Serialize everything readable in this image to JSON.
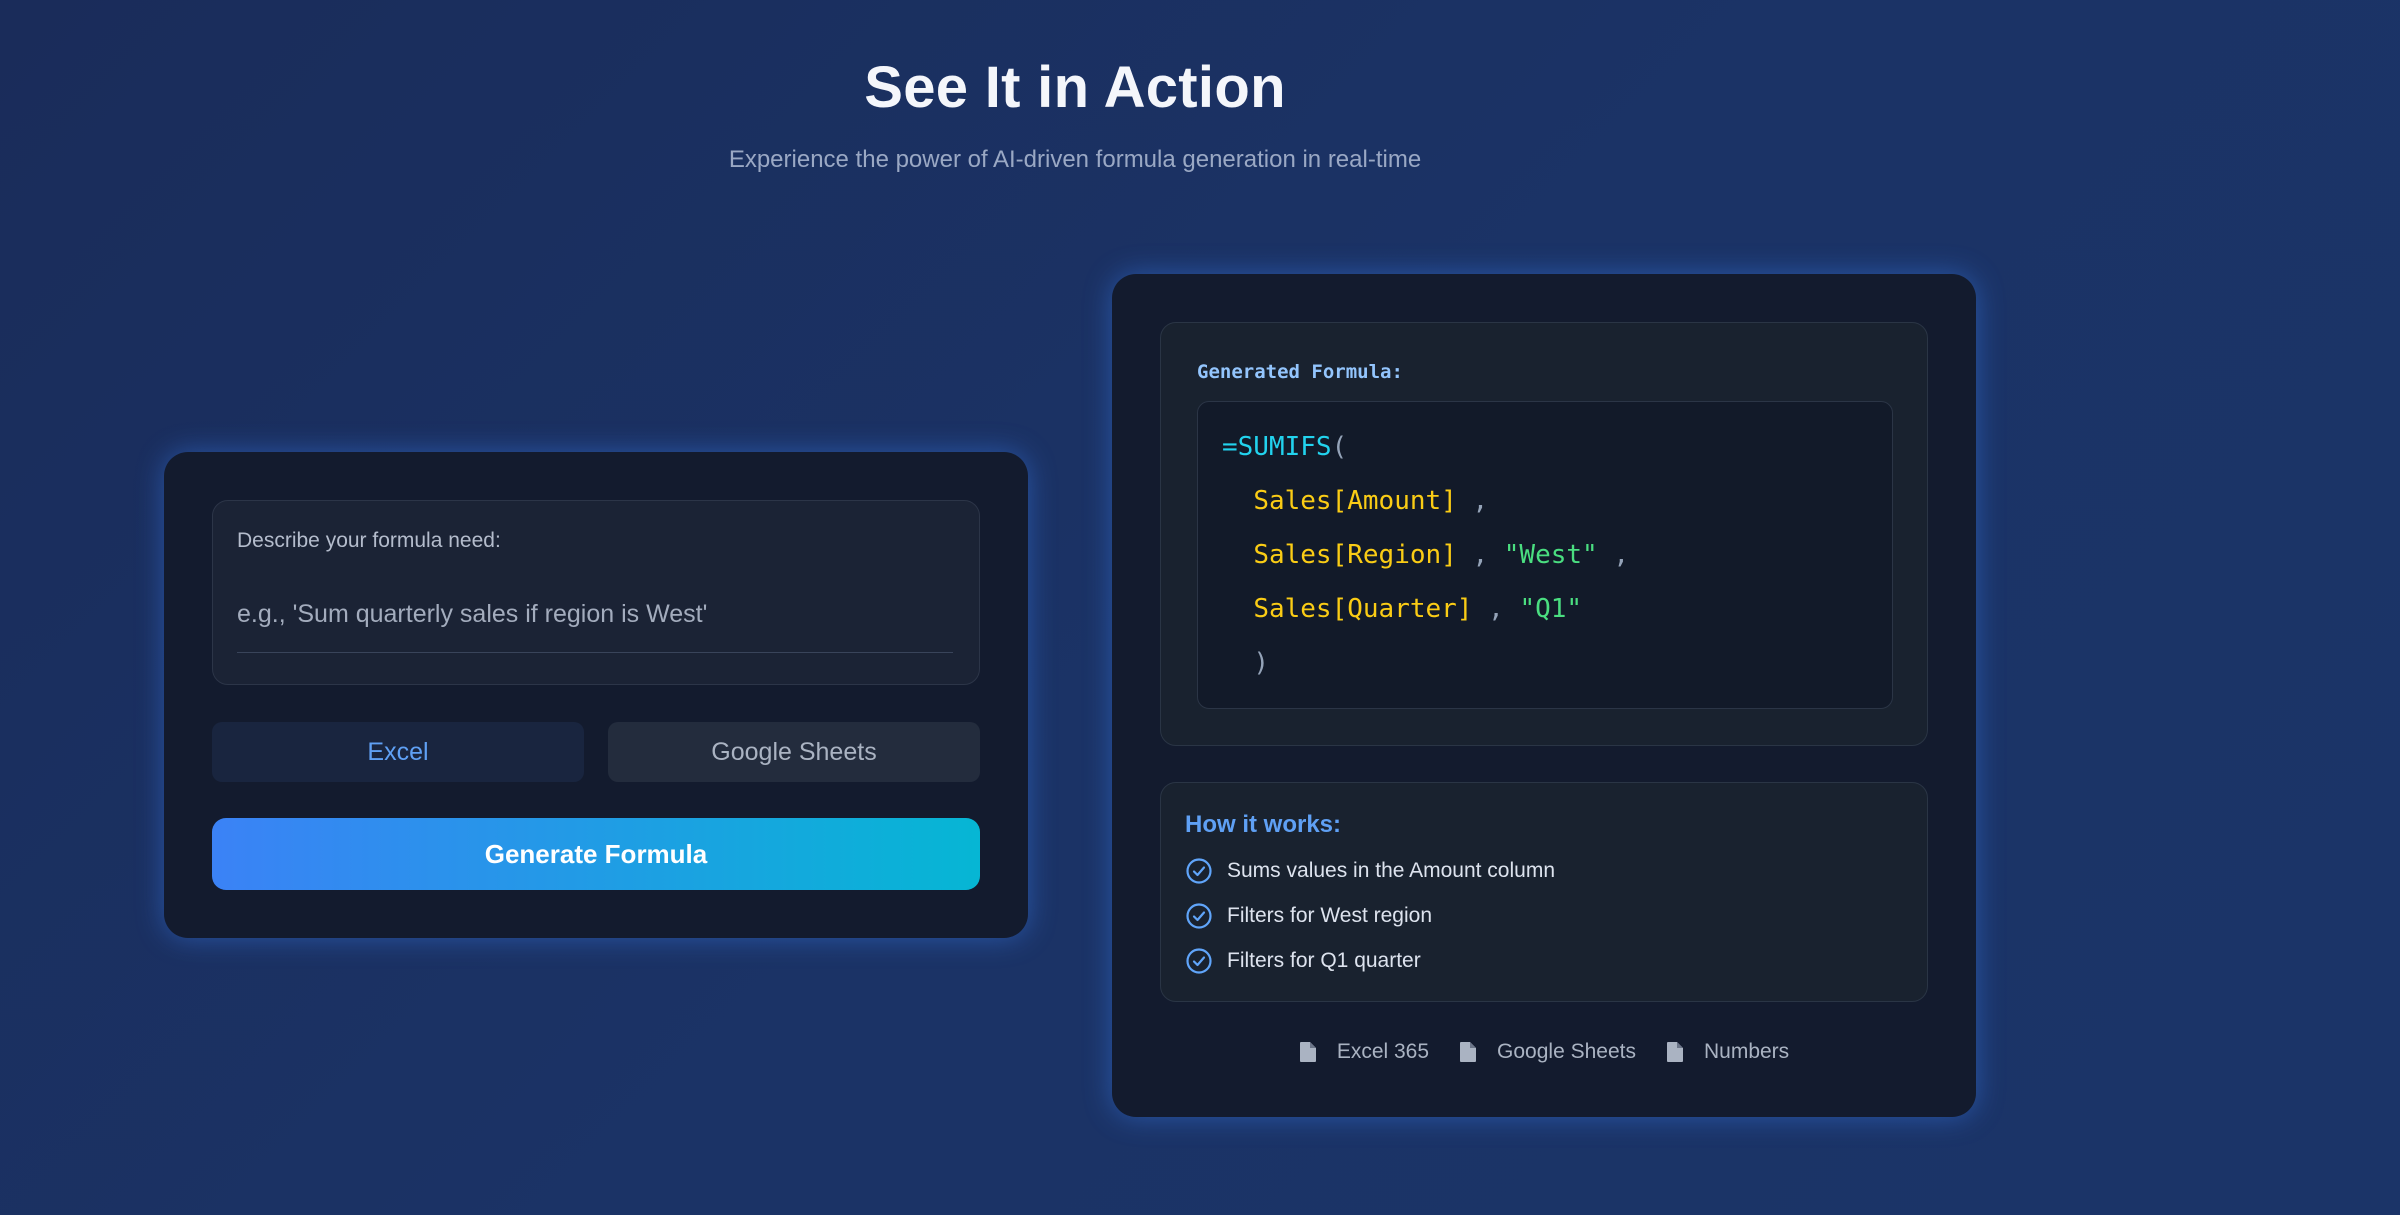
{
  "hero": {
    "title": "See It in Action",
    "subtitle": "Experience the power of AI-driven formula generation in real-time"
  },
  "input_card": {
    "label": "Describe your formula need:",
    "placeholder": "e.g., 'Sum quarterly sales if region is West'",
    "platforms": {
      "excel": "Excel",
      "sheets": "Google Sheets",
      "selected": "Excel"
    },
    "generate_label": "Generate Formula"
  },
  "output_card": {
    "heading": "Generated Formula:",
    "formula": {
      "fn": "=SUMIFS",
      "open": "(",
      "ref_amount": "Sales[Amount]",
      "ref_region": "Sales[Region]",
      "str_west": "\"West\"",
      "ref_quarter": "Sales[Quarter]",
      "str_q1": "\"Q1\"",
      "comma": ",",
      "close": ")"
    },
    "how": {
      "heading": "How it works:",
      "items": [
        "Sums values in the Amount column",
        "Filters for West region",
        "Filters for Q1 quarter"
      ]
    },
    "compatible": [
      "Excel 365",
      "Google Sheets",
      "Numbers"
    ]
  },
  "colors": {
    "accent": "#3b82f6",
    "accent_end": "#06b6d4",
    "function": "#22d3ee",
    "reference": "#facc15",
    "string": "#4ade80"
  }
}
